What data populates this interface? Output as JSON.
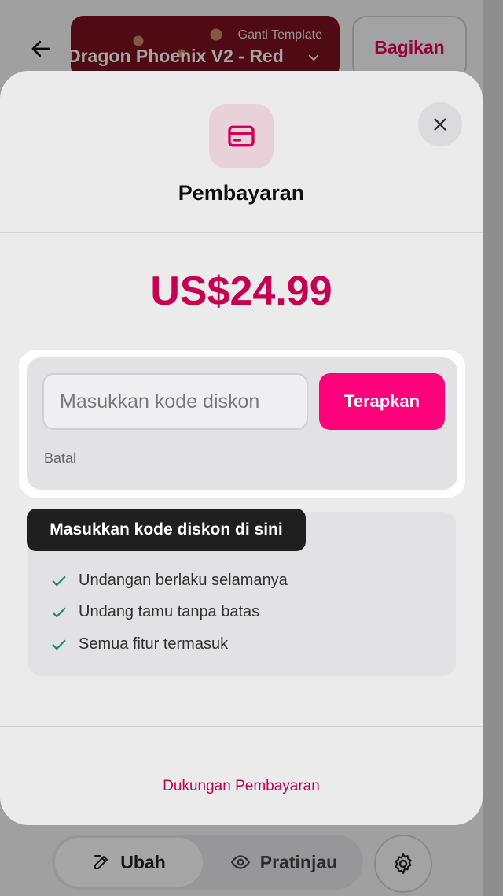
{
  "header": {
    "template_hint": "Ganti Template",
    "template_name": "Dragon Phoenix V2 - Red",
    "share_label": "Bagikan"
  },
  "bottom_nav": {
    "edit_label": "Ubah",
    "preview_label": "Pratinjau"
  },
  "payment_modal": {
    "title": "Pembayaran",
    "price": "US$24.99",
    "discount": {
      "placeholder": "Masukkan kode diskon",
      "value": "",
      "apply_label": "Terapkan",
      "cancel_label": "Batal"
    },
    "tooltip": "Masukkan kode diskon di sini",
    "features": [
      "Undangan berlaku selamanya",
      "Undang tamu tanpa batas",
      "Semua fitur termasuk"
    ],
    "support_label": "Dukungan Pembayaran"
  },
  "colors": {
    "accent": "#ff007a",
    "price": "#d6005a",
    "check": "#1aa06b"
  },
  "icons": [
    "arrow-left-icon",
    "chevron-down-icon",
    "close-icon",
    "credit-card-icon",
    "check-icon",
    "pencil-icon",
    "eye-icon",
    "gear-icon"
  ]
}
